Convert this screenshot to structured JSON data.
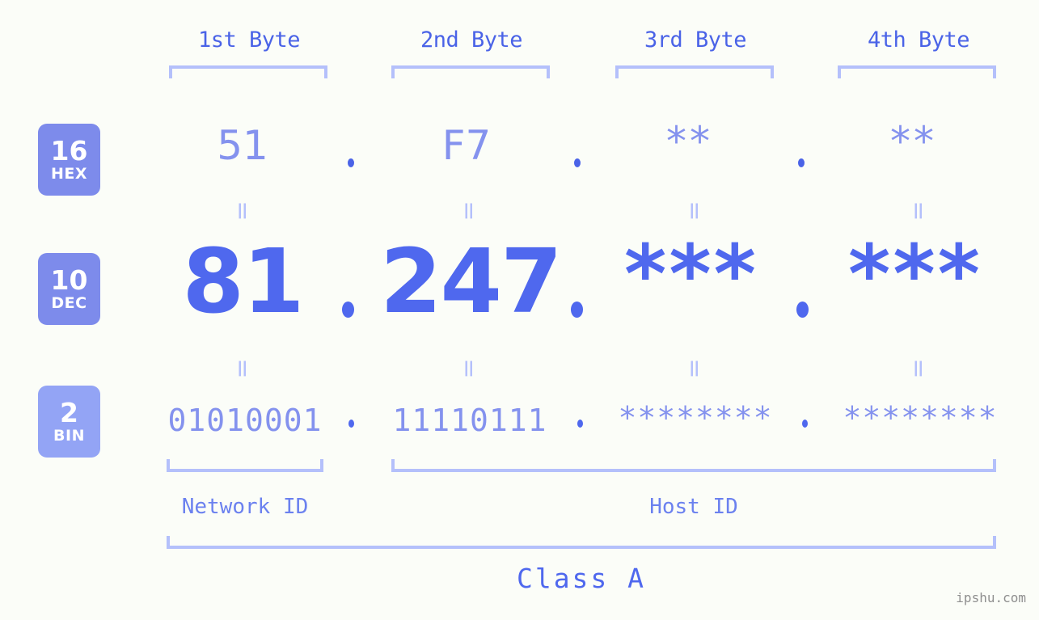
{
  "background": "#fbfdf8",
  "accent": "#4f68ee",
  "accent_light": "#8492ee",
  "accent_pale": "#b4c0fb",
  "badge_bg": "#7d8beb",
  "badge_bg_light": "#93a4f5",
  "headers": {
    "byte1": "1st Byte",
    "byte2": "2nd Byte",
    "byte3": "3rd Byte",
    "byte4": "4th Byte"
  },
  "radix": {
    "hex": {
      "number": "16",
      "name": "HEX"
    },
    "dec": {
      "number": "10",
      "name": "DEC"
    },
    "bin": {
      "number": "2",
      "name": "BIN"
    }
  },
  "rows": {
    "hex": {
      "b1": "51",
      "b2": "F7",
      "b3": "**",
      "b4": "**",
      "sep": "."
    },
    "dec": {
      "b1": "81",
      "b2": "247",
      "b3": "***",
      "b4": "***",
      "sep": "."
    },
    "bin": {
      "b1": "01010001",
      "b2": "11110111",
      "b3": "********",
      "b4": "********",
      "sep": "."
    }
  },
  "connectors": {
    "eq": "="
  },
  "captions": {
    "network_id": "Network ID",
    "host_id": "Host ID",
    "class": "Class A"
  },
  "watermark": "ipshu.com"
}
